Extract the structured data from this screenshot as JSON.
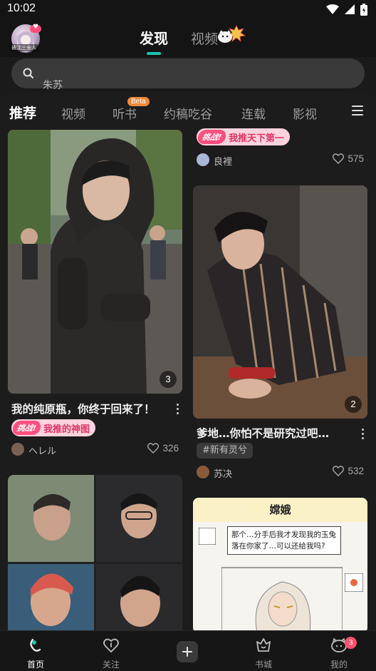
{
  "status_bar": {
    "time": "10:02"
  },
  "header": {
    "avatar_caption": "被沈三全人",
    "tabs": [
      {
        "label": "发现",
        "active": true
      },
      {
        "label": "视频",
        "active": false
      }
    ]
  },
  "search": {
    "placeholder": "朱苏"
  },
  "categories": [
    {
      "label": "推荐",
      "active": true
    },
    {
      "label": "视频"
    },
    {
      "label": "听书",
      "badge": "Beta"
    },
    {
      "label": "约稿吃谷"
    },
    {
      "label": "连载"
    },
    {
      "label": "影视"
    }
  ],
  "feed": {
    "left": [
      {
        "image_count": "3",
        "title": "我的纯原瓶，你终于回来了！",
        "challenge": {
          "flag": "挑战!",
          "text": "我推的神图"
        },
        "author": "ヘレル",
        "likes": "326"
      },
      {
        "image_count": ""
      }
    ],
    "right": [
      {
        "challenge": {
          "flag": "挑战!",
          "text": "我推天下第一"
        },
        "author": "良裡",
        "likes": "575"
      },
      {
        "image_count": "2",
        "title": "爹地…你怕不是研究过吧…",
        "topic": "#新有灵兮",
        "author": "苏决",
        "likes": "532"
      },
      {
        "comic_title": "嫦娥",
        "comic_bubble": "那个…分手后我才发现我的玉兔落在你家了…可以还给我吗?"
      }
    ]
  },
  "bottom_nav": [
    {
      "label": "首页",
      "active": true,
      "icon": "home-icon"
    },
    {
      "label": "关注",
      "icon": "follow-icon"
    },
    {
      "label": "",
      "icon": "plus-icon"
    },
    {
      "label": "书城",
      "icon": "bookstore-icon"
    },
    {
      "label": "我的",
      "icon": "profile-icon",
      "badge": "3"
    }
  ],
  "colors": {
    "accent": "#19c4b0",
    "challenge_pink": "#ff4f7e",
    "badge_red": "#ff4f6a"
  }
}
